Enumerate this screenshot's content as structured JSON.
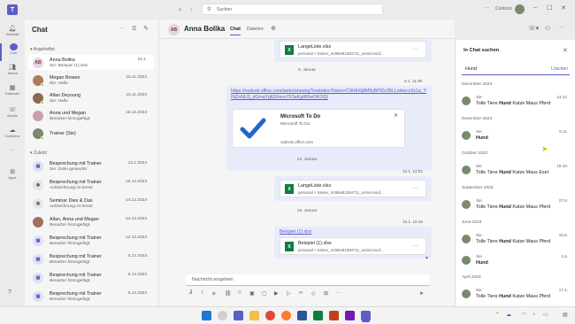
{
  "titlebar": {
    "search_placeholder": "Suchen",
    "org": "Contoso"
  },
  "rail": [
    {
      "label": "Aktivität",
      "icon": "bell-icon"
    },
    {
      "label": "Chat",
      "icon": "chat-icon"
    },
    {
      "label": "Teams",
      "icon": "teams-icon"
    },
    {
      "label": "Kalender",
      "icon": "calendar-icon"
    },
    {
      "label": "Anrufe",
      "icon": "phone-icon"
    },
    {
      "label": "OneDrive",
      "icon": "cloud-icon"
    },
    {
      "label": "Apps",
      "icon": "apps-icon"
    }
  ],
  "chatlist": {
    "title": "Chat",
    "pinned_header": "Angeheftet",
    "recent_header": "Zuletzt",
    "pinned": [
      {
        "initials": "AB",
        "name": "Anna Bolika",
        "preview": "Sie: Beispiel (1).xlsx",
        "date": "15.1."
      },
      {
        "name": "Megan Bowen",
        "preview": "Sie: Hallo",
        "date": "15.11.2022"
      },
      {
        "name": "Allan Deyoung",
        "preview": "Sie: Hallo",
        "date": "15.11.2022"
      },
      {
        "name": "Anna und Megan",
        "preview": "Benutzer hinzugefügt.",
        "date": "18.12.2023"
      },
      {
        "name": "Trainer (Sie)",
        "preview": "",
        "date": ""
      }
    ],
    "recent": [
      {
        "name": "Besprechung mit Trainer",
        "preview": "Sie: Datei gesendet",
        "date": "12.1.2024"
      },
      {
        "name": "Besprechung mit Trainer",
        "preview": "Aufzeichnung ist bereit",
        "date": "18.12.2023"
      },
      {
        "name": "Seminar Dies & Das",
        "preview": "Aufzeichnung ist bereit",
        "date": "14.12.2023"
      },
      {
        "name": "Allan, Anna und Megan",
        "preview": "Benutzer hinzugefügt.",
        "date": "14.12.2023"
      },
      {
        "name": "Besprechung mit Trainer",
        "preview": "Benutzer hinzugefügt.",
        "date": "12.12.2023"
      },
      {
        "name": "Besprechung mit Trainer",
        "preview": "Benutzer hinzugefügt.",
        "date": "6.12.2023"
      },
      {
        "name": "Besprechung mit Trainer",
        "preview": "Benutzer hinzugefügt.",
        "date": "6.12.2023"
      },
      {
        "name": "Besprechung mit Trainer",
        "preview": "Benutzer hinzugefügt.",
        "date": "6.12.2023"
      }
    ]
  },
  "header": {
    "initials": "AB",
    "name": "Anna Bolika",
    "tab_chat": "Chat",
    "tab_files": "Dateien"
  },
  "messages": {
    "file1_name": "LangeListe.xlsx",
    "file_path": "personal > trainer_m365x81384711_onmicrosof...",
    "date_sep1": "9. Januar",
    "meta1": "9.1. 11:39",
    "link": "https://outlook.office.com/tasks/sharing?InvitationToken=CWHh5j8M9yBPfZn35LLoHwcx3x1a_YINZnNU3_dGmaYgE5Fevo7F3aKgtR0wOKOQI",
    "preview_title": "Microsoft To Do",
    "preview_sub": "Microsoft To Do",
    "preview_url": "outlook.office.com",
    "date_sep2": "12. Januar",
    "meta2": "12.1. 14:51",
    "file2_name": "LangeListe.xlsx",
    "date_sep3": "15. Januar",
    "meta3": "15.1. 10:15",
    "link2": "Beispiel (1).xlsx",
    "file3_name": "Beispiel (1).xlsx",
    "compose_placeholder": "Nachricht eingeben"
  },
  "search": {
    "title": "In Chat suchen",
    "query": "Hund",
    "clear": "Löschen",
    "groups": [
      {
        "month": "December 2023",
        "items": [
          {
            "who": "Sie",
            "text_pre": "Tolle Tiere ",
            "hit": "Hund",
            "text_post": " Katze Maus Pferd",
            "date": "14.12."
          }
        ]
      },
      {
        "month": "November 2023",
        "items": [
          {
            "who": "Sie",
            "text_pre": "",
            "hit": "Hund",
            "text_post": "",
            "date": "6.11."
          }
        ]
      },
      {
        "month": "October 2023",
        "items": [
          {
            "who": "Sie",
            "text_pre": "Tolle Tiere ",
            "hit": "Hund",
            "text_post": " Katze Maus Esel",
            "date": "19.10."
          }
        ]
      },
      {
        "month": "September 2023",
        "items": [
          {
            "who": "Sie",
            "text_pre": "Tolle Tiere ",
            "hit": "Hund",
            "text_post": " Katze Maus Pferd",
            "date": "27.9."
          }
        ]
      },
      {
        "month": "June 2023",
        "items": [
          {
            "who": "Sie",
            "text_pre": "Tolle Tiere ",
            "hit": "Hund",
            "text_post": " Katze Maus Pferd",
            "date": "16.6."
          },
          {
            "who": "Sie",
            "text_pre": "",
            "hit": "Hund",
            "text_post": "",
            "date": "1.6."
          }
        ]
      },
      {
        "month": "April 2023",
        "items": [
          {
            "who": "Sie",
            "text_pre": "Tolle Tiere ",
            "hit": "Hund",
            "text_post": " Katze Maus Pferd",
            "date": "17.4."
          }
        ]
      }
    ]
  },
  "colors": {
    "accent": "#5b5fc7",
    "bubble": "#e8ebfa",
    "excel": "#107c41",
    "online": "#6bb700"
  }
}
